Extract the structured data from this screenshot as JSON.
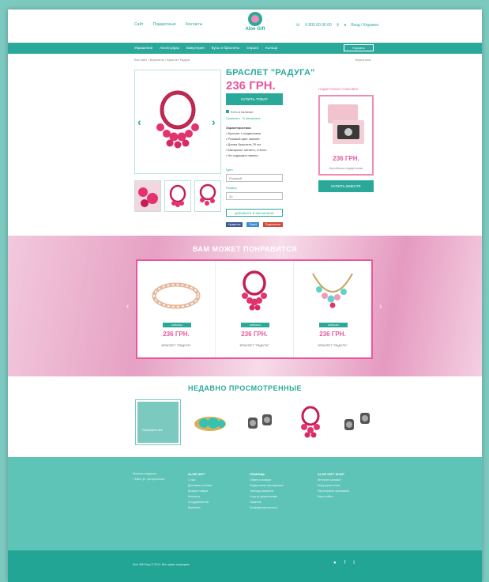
{
  "header": {
    "top_links": [
      "Сайт",
      "Подарочные",
      "Контакты"
    ],
    "logo_text": "Aloe Gift",
    "phone": "0 800 00 00 00",
    "login": "Вход / Корзина"
  },
  "nav": {
    "items": [
      "Украшения",
      "Аксессуары",
      "Бижутерия",
      "Бусы и браслеты",
      "Серьги",
      "Кольца"
    ],
    "cart_label": "Корзина"
  },
  "breadcrumb": "Все сайт / Браслеты / Браслет Радуга",
  "back_link": "Вернуться",
  "product": {
    "title": "БРАСЛЕТ \"РАДУГА\"",
    "price": "236 ГРН.",
    "buy_label": "КУПИТЬ ТОВАР",
    "availability": "Есть в наличии",
    "compare": "Сравнить",
    "wishlist": "В желаемое",
    "desc_title": "Характеристики",
    "desc_lines": [
      "• Браслет с подвесками",
      "• Розовый цвет камней",
      "• Длина браслета 20 см",
      "• Материал: металл, стекло",
      "• Не содержит никеля"
    ],
    "color_label": "Цвет",
    "color_value": "Розовый",
    "size_label": "Размер",
    "size_value": "20",
    "add_wishlist": "ДОБАВИТЬ В ЖЕЛАЕМОЕ",
    "share": [
      "Нравится",
      "Tweet",
      "Поделиться"
    ]
  },
  "gift_box": {
    "title": "ПОДАРОЧНАЯ УПАКОВКА",
    "price": "236 ГРН.",
    "name": "Коробочка подарочная",
    "button": "КУПИТЬ ВМЕСТЕ"
  },
  "recommend": {
    "title": "ВАМ МОЖЕТ ПОНРАВИТСЯ",
    "cards": [
      {
        "badge": "НОВИНКА",
        "price": "236 ГРН.",
        "name": "БРАСЛЕТ \"РАДУГА\""
      },
      {
        "badge": "НОВИНКА",
        "price": "236 ГРН.",
        "name": "БРАСЛЕТ \"РАДУГА\""
      },
      {
        "badge": "НОВИНКА",
        "price": "236 ГРН.",
        "name": "БРАСЛЕТ \"РАДУГА\""
      }
    ]
  },
  "recent": {
    "title": "НЕДАВНО ПРОСМОТРЕННЫЕ",
    "first_label": "Посмотреть все"
  },
  "footer": {
    "about": [
      "Магазин подарков",
      "г. Киев, ул. Центральная"
    ],
    "col1_title": "ALOE GIFT",
    "col1": [
      "О нас",
      "Доставка и оплата",
      "Возврат товара",
      "Контакты",
      "Сотрудничество",
      "Вакансии"
    ],
    "col2_title": "ПОМОЩЬ",
    "col2": [
      "Обмен и возврат",
      "Подарочные сертификаты",
      "Таблица размеров",
      "Уход за украшениями",
      "Гарантия",
      "Конфиденциальность"
    ],
    "col3_title": "ALOE GIFT SHOP",
    "col3": [
      "Интернет-магазин",
      "Бижутерия оптом",
      "Партнерская программа",
      "Карта сайта"
    ],
    "copyright": "Aloe Gift Shop © 2014. Все права защищены",
    "social": [
      "●",
      "f",
      "t"
    ]
  },
  "colors": {
    "teal": "#2aa99a",
    "pink": "#e8579d",
    "light_pink": "#f08bb3"
  }
}
